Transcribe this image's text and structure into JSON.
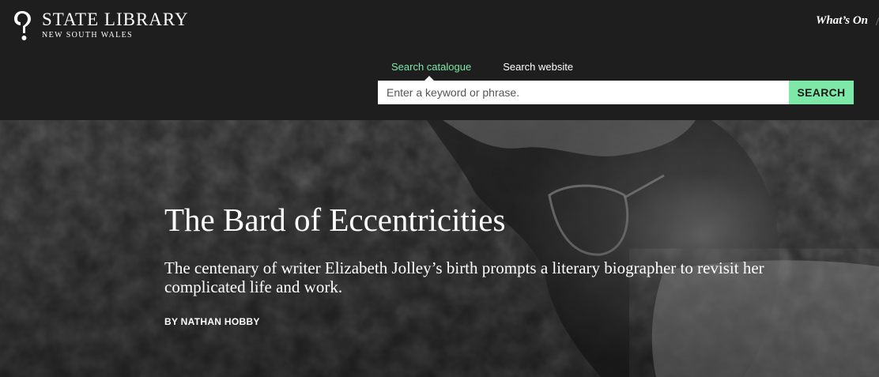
{
  "header": {
    "logo_title": "STATE LIBRARY",
    "logo_subtitle": "NEW SOUTH WALES",
    "whats_on": "What’s On",
    "whats_on_slash": "/"
  },
  "search": {
    "tabs": [
      {
        "label": "Search catalogue",
        "active": true
      },
      {
        "label": "Search website",
        "active": false
      }
    ],
    "placeholder": "Enter a keyword or phrase.",
    "value": "",
    "button_label": "SEARCH"
  },
  "hero": {
    "title": "The Bard of Eccentricities",
    "subtitle": "The centenary of writer Elizabeth Jolley’s birth prompts a literary biographer to revisit her complicated life and work.",
    "byline": "BY NATHAN HOBBY"
  },
  "colors": {
    "header_bg": "#1e1e1e",
    "accent": "#7ee8a8",
    "text": "#ffffff"
  },
  "icons": {
    "logo": "state-library-logo-icon",
    "tab_indicator": "caret-up-icon"
  }
}
